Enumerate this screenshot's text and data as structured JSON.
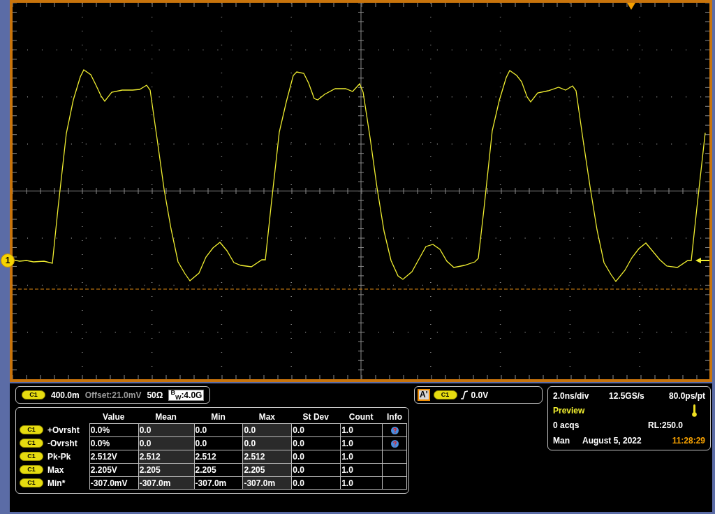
{
  "display": {
    "channel_marker": "1"
  },
  "vertical_readout": {
    "channel": "C1",
    "scale": "400.0m",
    "offset": "Offset:21.0mV",
    "termination": "50Ω",
    "bandwidth": "$^{B}$$_{W}$:4.0G"
  },
  "measurements": {
    "columns": [
      "Value",
      "Mean",
      "Min",
      "Max",
      "St Dev",
      "Count",
      "Info"
    ],
    "rows": [
      {
        "channel": "C1",
        "name": "+Ovrsht",
        "cells": [
          "0.0%",
          "0.0",
          "0.0",
          "0.0",
          "0.0",
          "1.0"
        ],
        "info": true
      },
      {
        "channel": "C1",
        "name": "-Ovrsht",
        "cells": [
          "0.0%",
          "0.0",
          "0.0",
          "0.0",
          "0.0",
          "1.0"
        ],
        "info": true
      },
      {
        "channel": "C1",
        "name": "Pk-Pk",
        "cells": [
          "2.512V",
          "2.512",
          "2.512",
          "2.512",
          "0.0",
          "1.0"
        ],
        "info": false
      },
      {
        "channel": "C1",
        "name": "Max",
        "cells": [
          "2.205V",
          "2.205",
          "2.205",
          "2.205",
          "0.0",
          "1.0"
        ],
        "info": false
      },
      {
        "channel": "C1",
        "name": "Min*",
        "cells": [
          "-307.0mV",
          "-307.0m",
          "-307.0m",
          "-307.0m",
          "0.0",
          "1.0"
        ],
        "info": false
      }
    ]
  },
  "trigger": {
    "mode": "A'",
    "channel": "C1",
    "threshold": "0.0V"
  },
  "timebase": {
    "scale": "2.0ns/div",
    "sample_rate": "12.5GS/s",
    "resolution": "80.0ps/pt",
    "state": "Preview",
    "acquisitions": "0 acqs",
    "record_length": "RL:250.0",
    "mode": "Man",
    "date": "August 5, 2022",
    "time": "11:28:29"
  }
}
